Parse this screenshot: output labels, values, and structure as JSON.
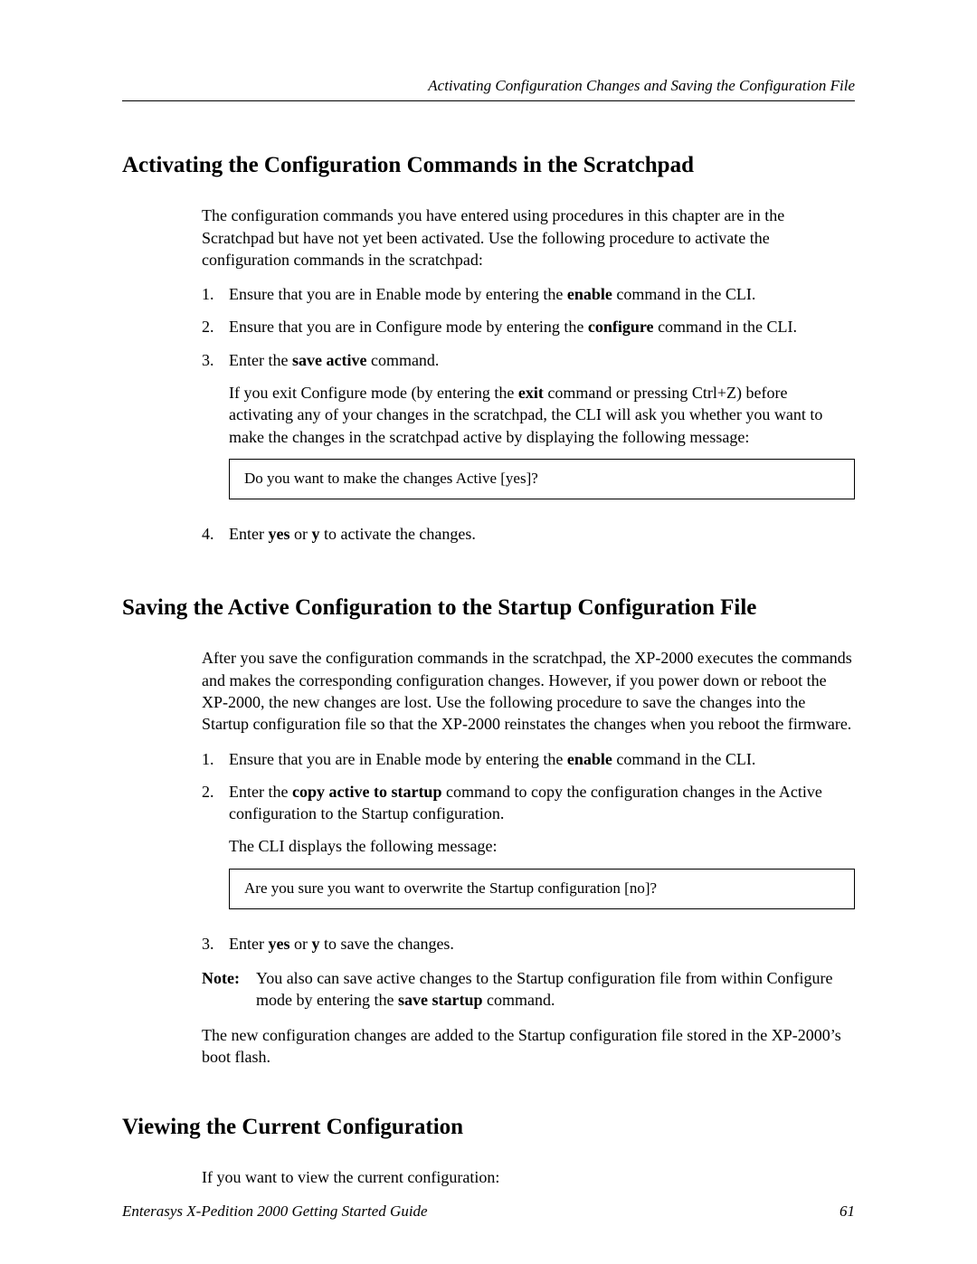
{
  "running_head": "Activating Configuration Changes and Saving the Configuration File",
  "section1": {
    "heading": "Activating the Configuration Commands in the Scratchpad",
    "intro": "The configuration commands you have entered using procedures in this chapter are in the Scratchpad but have not yet been activated. Use the following procedure to activate the configuration commands in the scratchpad:",
    "step1_pre": "Ensure that you are in Enable mode by entering the ",
    "step1_cmd": "enable",
    "step1_post": " command in the CLI.",
    "step2_pre": "Ensure that you are in Configure mode by entering the ",
    "step2_cmd": "configure",
    "step2_post": " command in the CLI.",
    "step3_pre": "Enter the ",
    "step3_cmd": "save active",
    "step3_post": " command.",
    "step3_para2_a": "If you exit Configure mode (by entering the ",
    "step3_para2_cmd": "exit",
    "step3_para2_b": " command or pressing Ctrl+Z) before activating any of your changes in the scratchpad, the CLI will ask you whether you want to make the changes in the scratchpad active by displaying the following message:",
    "cli_box": "Do you want to make the changes Active [yes]?",
    "step4_pre": "Enter ",
    "step4_cmd1": "yes",
    "step4_mid": " or ",
    "step4_cmd2": "y",
    "step4_post": " to activate the changes."
  },
  "section2": {
    "heading": "Saving the Active Configuration to the Startup Configuration File",
    "intro": "After you save the configuration commands in the scratchpad, the XP-2000 executes the commands and makes the corresponding configuration changes. However, if you power down or reboot the XP-2000, the new changes are lost. Use the following procedure to save the changes into the Startup configuration file so that the XP-2000 reinstates the changes when you reboot the firmware.",
    "step1_pre": "Ensure that you are in Enable mode by entering the ",
    "step1_cmd": "enable",
    "step1_post": " command in the CLI.",
    "step2_pre": "Enter the ",
    "step2_cmd": "copy active to startup",
    "step2_post": " command to copy the configuration changes in the Active configuration to the Startup configuration.",
    "step2_para2": "The CLI displays the following message:",
    "cli_box": "Are you sure you want to overwrite the Startup configuration [no]?",
    "step3_pre": "Enter ",
    "step3_cmd1": "yes",
    "step3_mid": " or ",
    "step3_cmd2": "y",
    "step3_post": " to save the changes.",
    "note_label": "Note:",
    "note_a": "You also can save active changes to the Startup configuration file from within Configure mode by entering the ",
    "note_cmd": "save startup",
    "note_b": " command.",
    "outro": "The new configuration changes are added to the Startup configuration file stored in the XP-2000’s boot flash."
  },
  "section3": {
    "heading": "Viewing the Current Configuration",
    "intro": "If you want to view the current configuration:"
  },
  "footer": {
    "book": "Enterasys X-Pedition 2000 Getting Started Guide",
    "page": "61"
  },
  "nums": {
    "n1": "1.",
    "n2": "2.",
    "n3": "3.",
    "n4": "4."
  }
}
